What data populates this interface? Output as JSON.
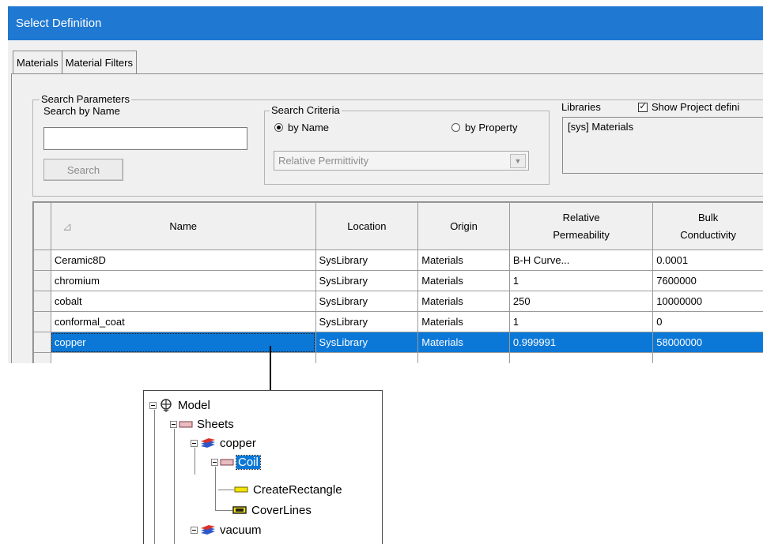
{
  "window": {
    "title": "Select Definition"
  },
  "tabs": [
    {
      "label": "Materials",
      "active": true
    },
    {
      "label": "Material Filters",
      "active": false
    }
  ],
  "search_parameters": {
    "group_label": "Search Parameters",
    "search_by_name_label": "Search by Name",
    "search_value": "",
    "search_button": "Search"
  },
  "search_criteria": {
    "group_label": "Search Criteria",
    "by_name_label": "by Name",
    "by_property_label": "by Property",
    "selected": "by Name",
    "property_select_value": "Relative Permittivity"
  },
  "libraries": {
    "label": "Libraries",
    "show_project_label": "Show Project defini",
    "show_project_checked": true,
    "items": [
      "[sys] Materials"
    ]
  },
  "table": {
    "columns": [
      "Name",
      "Location",
      "Origin",
      "Relative Permeability",
      "Bulk Conductivity"
    ],
    "column_lines": [
      [
        "Name"
      ],
      [
        "Location"
      ],
      [
        "Origin"
      ],
      [
        "Relative",
        "Permeability"
      ],
      [
        "Bulk",
        "Conductivity"
      ]
    ],
    "rows": [
      [
        "Ceramic8D",
        "SysLibrary",
        "Materials",
        "B-H Curve...",
        "0.0001"
      ],
      [
        "chromium",
        "SysLibrary",
        "Materials",
        "1",
        "7600000"
      ],
      [
        "cobalt",
        "SysLibrary",
        "Materials",
        "250",
        "10000000"
      ],
      [
        "conformal_coat",
        "SysLibrary",
        "Materials",
        "1",
        "0"
      ],
      [
        "copper",
        "SysLibrary",
        "Materials",
        "0.999991",
        "58000000"
      ]
    ],
    "selected_row": 4
  },
  "tree": {
    "nodes": [
      {
        "label": "Model",
        "icon": "model-icon"
      },
      {
        "label": "Sheets",
        "icon": "sheet-folder-icon"
      },
      {
        "label": "copper",
        "icon": "material-icon"
      },
      {
        "label": "Coil",
        "icon": "sheet-object-icon",
        "selected": true
      },
      {
        "label": "CreateRectangle",
        "icon": "create-operation-icon"
      },
      {
        "label": "CoverLines",
        "icon": "cover-lines-icon"
      },
      {
        "label": "vacuum",
        "icon": "material-icon"
      }
    ]
  },
  "colors": {
    "titlebar": "#1f78d1",
    "selection": "#0b78d7",
    "material_red": "#d9322b",
    "material_blue": "#2f56c9",
    "operation_yellow": "#f4e400"
  }
}
